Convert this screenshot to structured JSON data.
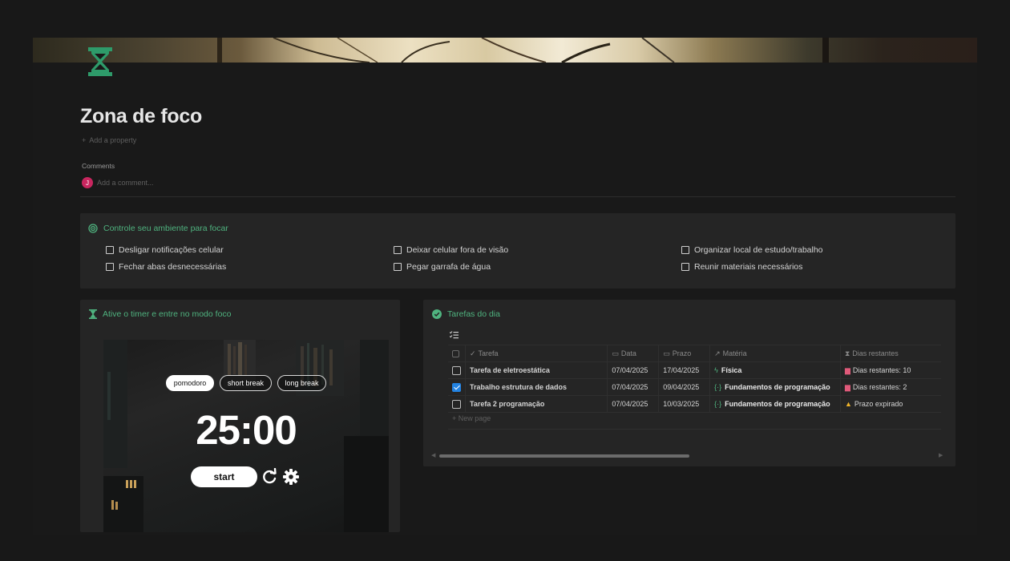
{
  "page": {
    "title": "Zona de foco",
    "icon": "hourglass-icon",
    "add_property": "Add a property",
    "comments_label": "Comments",
    "avatar_initial": "J",
    "comment_placeholder": "Add a comment...",
    "accent_color": "#4fb37f"
  },
  "ambiente": {
    "heading": "Controle seu ambiente para focar",
    "icon": "target-icon",
    "items": [
      "Desligar notificações celular",
      "Fechar abas desnecessárias",
      "Deixar celular fora de visão",
      "Pegar garrafa de água",
      "Organizar local de estudo/trabalho",
      "Reunir materiais necessários"
    ]
  },
  "timer": {
    "heading": "Ative o timer e entre no modo foco",
    "icon": "hourglass-icon",
    "modes": [
      "pomodoro",
      "short break",
      "long break"
    ],
    "active_mode": "pomodoro",
    "time": "25:00",
    "start_label": "start"
  },
  "tarefas": {
    "heading": "Tarefas do dia",
    "icon": "check-circle-icon",
    "columns": [
      "Tarefa",
      "Data",
      "Prazo",
      "Matéria",
      "Dias restantes"
    ],
    "rows": [
      {
        "done": false,
        "tarefa": "Tarefa de eletroestática",
        "data": "07/04/2025",
        "prazo": "17/04/2025",
        "materia": "Física",
        "materia_icon": "lightning-icon",
        "dias": "Dias restantes: 10",
        "dias_icon": "calendar-icon"
      },
      {
        "done": true,
        "tarefa": "Trabalho estrutura de dados",
        "data": "07/04/2025",
        "prazo": "09/04/2025",
        "materia": "Fundamentos de programação",
        "materia_icon": "braces-icon",
        "dias": "Dias restantes: 2",
        "dias_icon": "calendar-icon"
      },
      {
        "done": false,
        "tarefa": "Tarefa 2 programação",
        "data": "07/04/2025",
        "prazo": "10/03/2025",
        "materia": "Fundamentos de programação",
        "materia_icon": "braces-icon",
        "dias": "Prazo expirado",
        "dias_icon": "warning-icon"
      }
    ],
    "new_page": "New page"
  }
}
